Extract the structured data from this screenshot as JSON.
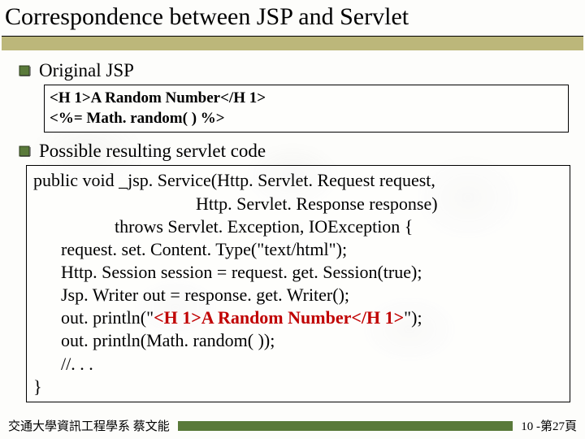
{
  "title": "Correspondence between JSP and Servlet",
  "bullets": {
    "b1": "Original JSP",
    "b2": "Possible resulting servlet code"
  },
  "jsp_code": {
    "line1": "<H 1>A Random Number</H 1>",
    "line2": "<%= Math. random( ) %>"
  },
  "servlet_code": {
    "l1": "public void _jsp. Service(Http. Servlet. Request request,",
    "l2": "Http. Servlet. Response response)",
    "l3": "throws Servlet. Exception, IOException {",
    "l4": "request. set. Content. Type(\"text/html\");",
    "l5": "Http. Session session = request. get. Session(true);",
    "l6": "Jsp. Writer out = response. get. Writer();",
    "l7a": "out. println(\"",
    "l7b": "<H 1>A Random Number</H 1>",
    "l7c": "\");",
    "l8": "out. println(Math. random( ));",
    "l9": "//. . .",
    "l10": "}"
  },
  "footer": {
    "left": "交通大學資訊工程學系 蔡文能",
    "right": "10 -第27頁"
  }
}
